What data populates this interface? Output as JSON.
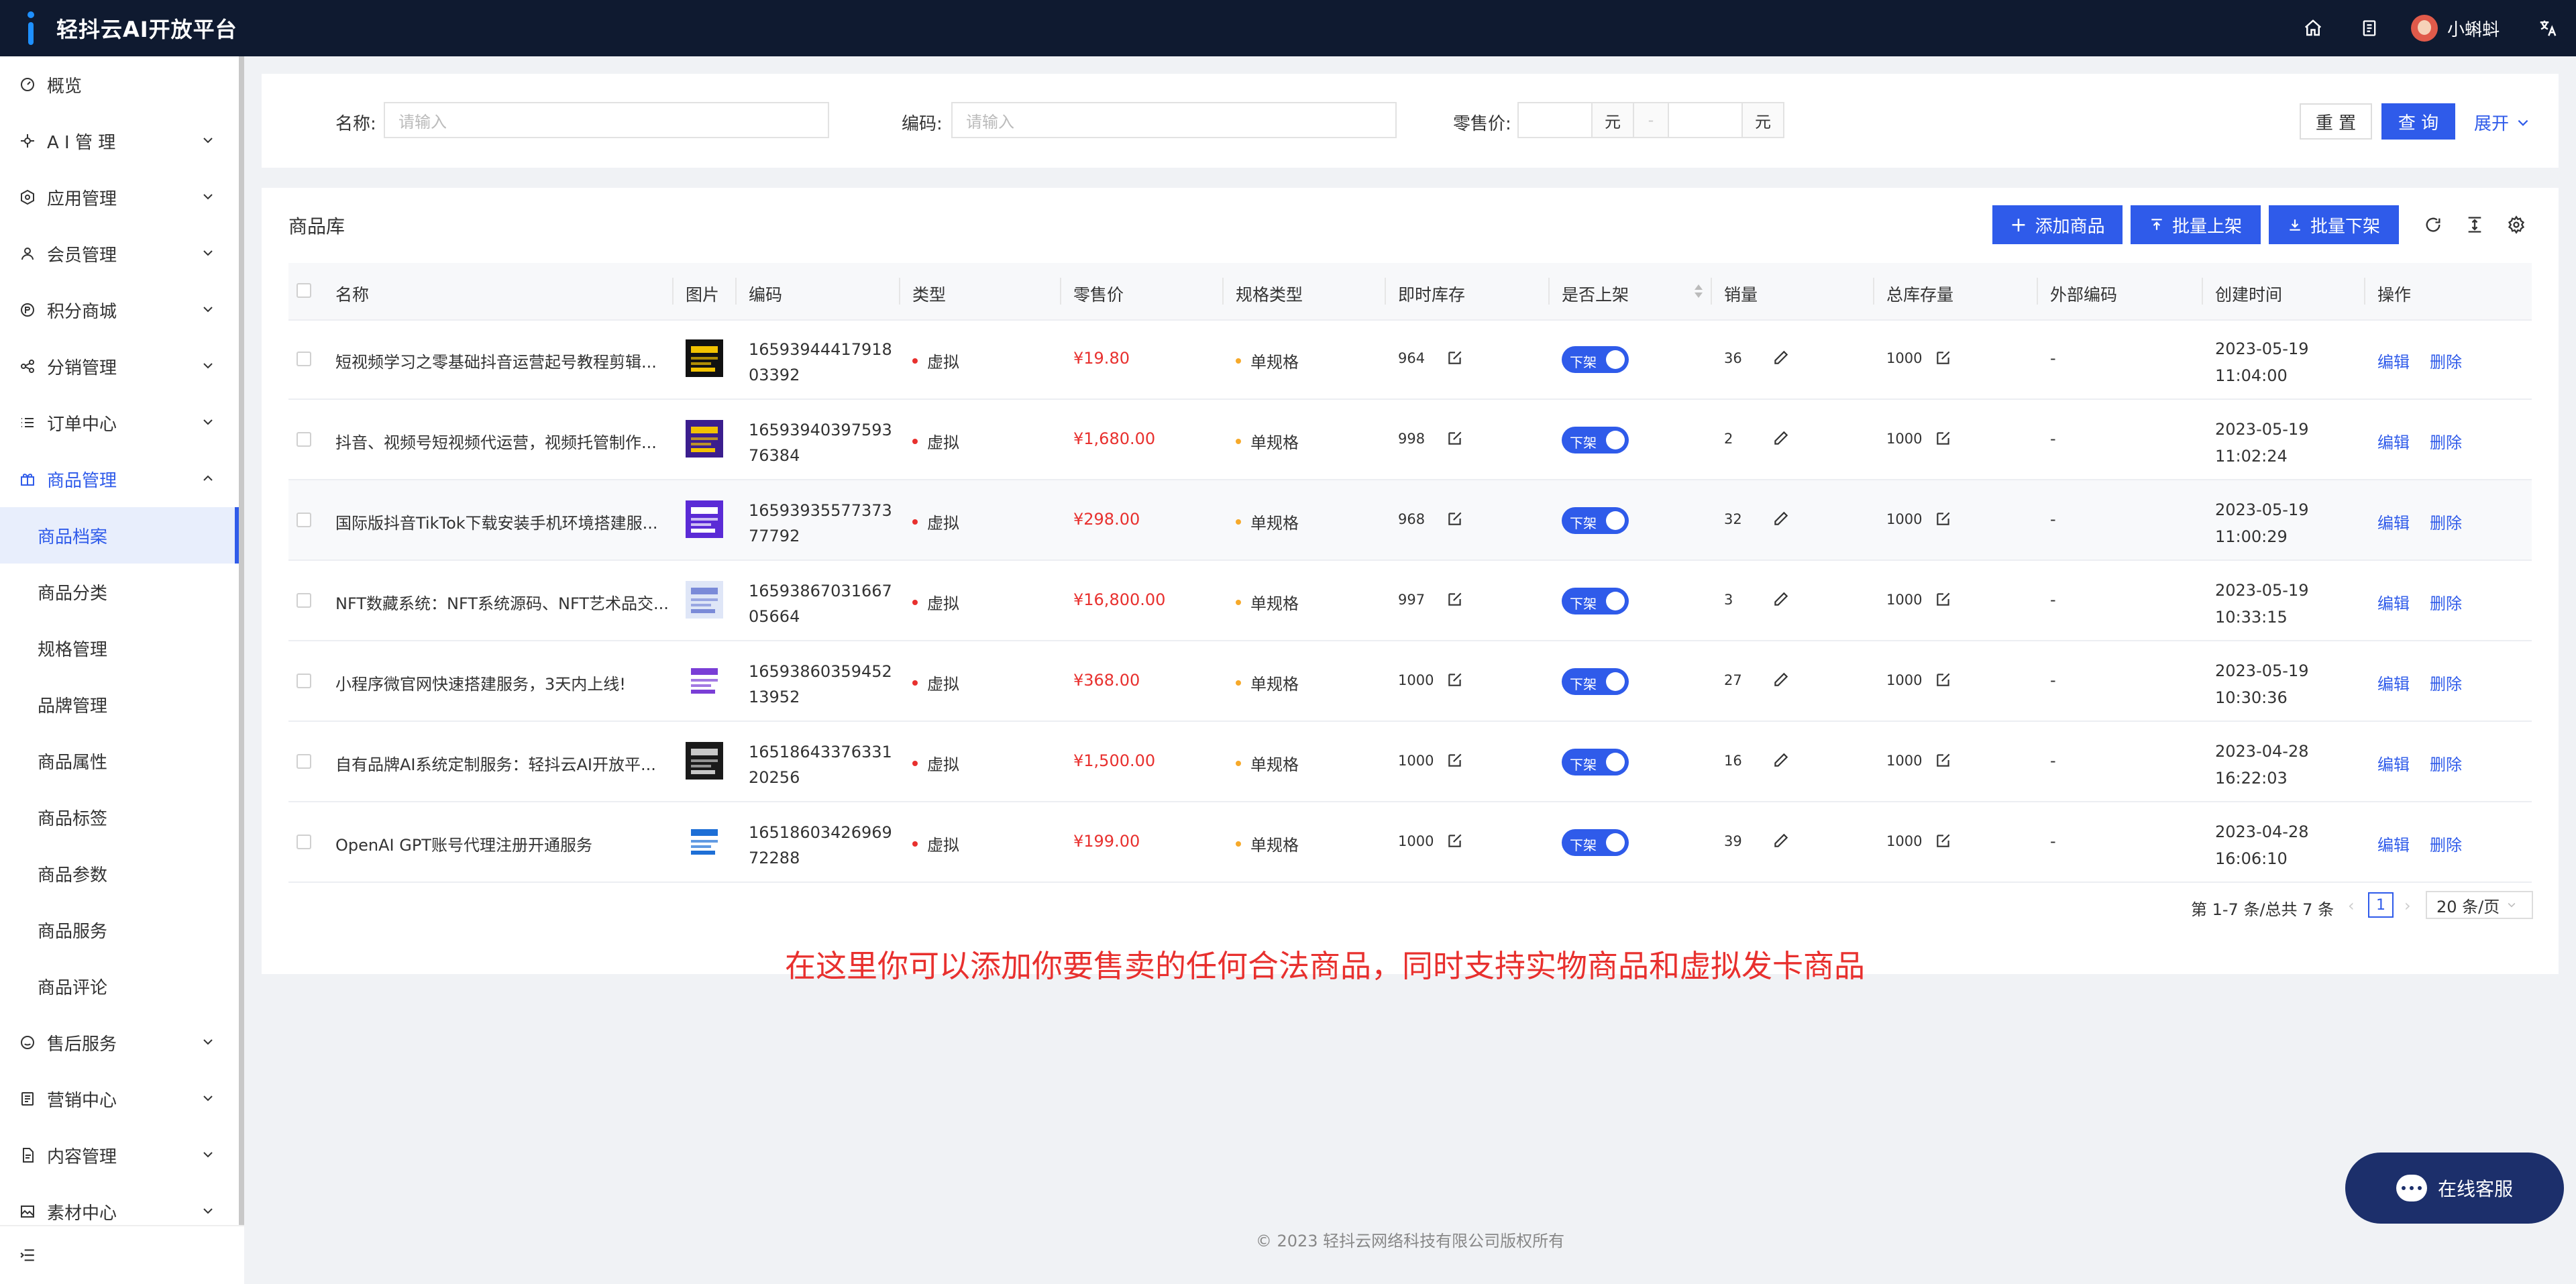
{
  "app": {
    "title": "轻抖云AI开放平台",
    "username": "小蝌蚪"
  },
  "sidebar": {
    "items": [
      {
        "label": "概览",
        "icon": "dashboard-icon"
      },
      {
        "label": "A I 管 理",
        "icon": "ai-icon"
      },
      {
        "label": "应用管理",
        "icon": "app-icon"
      },
      {
        "label": "会员管理",
        "icon": "user-icon"
      },
      {
        "label": "积分商城",
        "icon": "points-icon"
      },
      {
        "label": "分销管理",
        "icon": "share-icon"
      },
      {
        "label": "订单中心",
        "icon": "list-icon"
      },
      {
        "label": "商品管理",
        "icon": "gift-icon"
      }
    ],
    "sub_items": [
      "商品档案",
      "商品分类",
      "规格管理",
      "品牌管理",
      "商品属性",
      "商品标签",
      "商品参数",
      "商品服务",
      "商品评论"
    ],
    "after_items": [
      {
        "label": "售后服务",
        "icon": "service-icon"
      },
      {
        "label": "营销中心",
        "icon": "marketing-icon"
      },
      {
        "label": "内容管理",
        "icon": "content-icon"
      },
      {
        "label": "素材中心",
        "icon": "image-icon"
      }
    ]
  },
  "filter": {
    "name_label": "名称:",
    "name_placeholder": "请输入",
    "code_label": "编码:",
    "code_placeholder": "请输入",
    "price_label": "零售价:",
    "unit": "元",
    "range_sep": "-",
    "reset": "重 置",
    "query": "查 询",
    "expand": "展开"
  },
  "table": {
    "title": "商品库",
    "add": "添加商品",
    "batch_on": "批量上架",
    "batch_off": "批量下架",
    "columns": [
      "名称",
      "图片",
      "编码",
      "类型",
      "零售价",
      "规格类型",
      "即时库存",
      "是否上架",
      "销量",
      "总库存量",
      "外部编码",
      "创建时间",
      "操作"
    ],
    "rows": [
      {
        "name": "短视频学习之零基础抖音运营起号教程剪辑...",
        "code": "1659394441791803392",
        "type": "虚拟",
        "price": "¥19.80",
        "spec": "单规格",
        "stock": "964",
        "status": "下架",
        "sales": "36",
        "total": "1000",
        "ext": "-",
        "date": "2023-05-19",
        "time": "11:04:00",
        "edit": "编辑",
        "del": "删除"
      },
      {
        "name": "抖音、视频号短视频代运营，视频托管制作...",
        "code": "1659394039759376384",
        "type": "虚拟",
        "price": "¥1,680.00",
        "spec": "单规格",
        "stock": "998",
        "status": "下架",
        "sales": "2",
        "total": "1000",
        "ext": "-",
        "date": "2023-05-19",
        "time": "11:02:24",
        "edit": "编辑",
        "del": "删除"
      },
      {
        "name": "国际版抖音TikTok下载安装手机环境搭建服...",
        "code": "1659393557737377792",
        "type": "虚拟",
        "price": "¥298.00",
        "spec": "单规格",
        "stock": "968",
        "status": "下架",
        "sales": "32",
        "total": "1000",
        "ext": "-",
        "date": "2023-05-19",
        "time": "11:00:29",
        "edit": "编辑",
        "del": "删除"
      },
      {
        "name": "NFT数藏系统：NFT系统源码、NFT艺术品交...",
        "code": "1659386703166705664",
        "type": "虚拟",
        "price": "¥16,800.00",
        "spec": "单规格",
        "stock": "997",
        "status": "下架",
        "sales": "3",
        "total": "1000",
        "ext": "-",
        "date": "2023-05-19",
        "time": "10:33:15",
        "edit": "编辑",
        "del": "删除"
      },
      {
        "name": "小程序微官网快速搭建服务，3天内上线!",
        "code": "1659386035945213952",
        "type": "虚拟",
        "price": "¥368.00",
        "spec": "单规格",
        "stock": "1000",
        "status": "下架",
        "sales": "27",
        "total": "1000",
        "ext": "-",
        "date": "2023-05-19",
        "time": "10:30:36",
        "edit": "编辑",
        "del": "删除"
      },
      {
        "name": "自有品牌AI系统定制服务：轻抖云AI开放平...",
        "code": "1651864337633120256",
        "type": "虚拟",
        "price": "¥1,500.00",
        "spec": "单规格",
        "stock": "1000",
        "status": "下架",
        "sales": "16",
        "total": "1000",
        "ext": "-",
        "date": "2023-04-28",
        "time": "16:22:03",
        "edit": "编辑",
        "del": "删除"
      },
      {
        "name": "OpenAI GPT账号代理注册开通服务",
        "code": "1651860342696972288",
        "type": "虚拟",
        "price": "¥199.00",
        "spec": "单规格",
        "stock": "1000",
        "status": "下架",
        "sales": "39",
        "total": "1000",
        "ext": "-",
        "date": "2023-04-28",
        "time": "16:06:10",
        "edit": "编辑",
        "del": "删除"
      }
    ]
  },
  "pagination": {
    "summary": "第 1-7 条/总共 7 条",
    "current": "1",
    "page_size": "20 条/页"
  },
  "annotation": "在这里你可以添加你要售卖的任何合法商品，同时支持实物商品和虚拟发卡商品",
  "footer": "© 2023 轻抖云网络科技有限公司版权所有",
  "chat": {
    "label": "在线客服"
  },
  "colors": {
    "accent": "#2f5bea",
    "price": "#e8302e",
    "topbar": "#0f1a30",
    "chat": "#1c2f6b"
  }
}
